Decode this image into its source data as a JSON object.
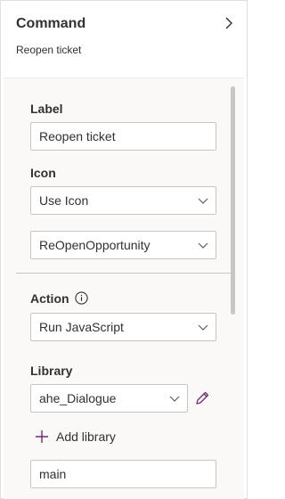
{
  "header": {
    "title": "Command",
    "subtitle": "Reopen ticket"
  },
  "form": {
    "label_field": {
      "label": "Label",
      "value": "Reopen ticket"
    },
    "icon_field": {
      "label": "Icon",
      "mode_value": "Use Icon",
      "icon_value": "ReOpenOpportunity"
    },
    "action_field": {
      "label": "Action",
      "value": "Run JavaScript"
    },
    "library_field": {
      "label": "Library",
      "value": "ahe_Dialogue",
      "add_label": "Add library",
      "function_value": "main"
    }
  },
  "colors": {
    "accent_purple": "#742774",
    "border": "#c8c6c4",
    "panel_bg": "#faf9f8"
  }
}
